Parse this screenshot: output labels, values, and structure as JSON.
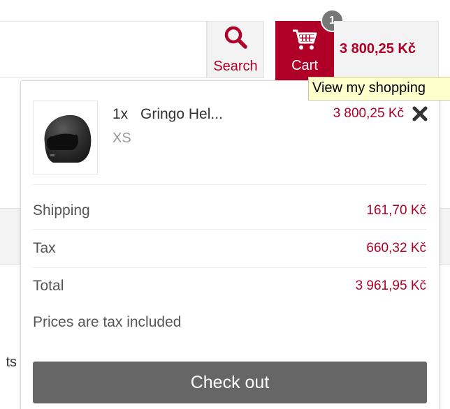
{
  "header": {
    "search_label": "Search",
    "cart_label": "Cart",
    "cart_count": "1",
    "cart_total": "3 800,25 Kč",
    "cart_tooltip": "View my shopping",
    "search_icon": "search-icon",
    "cart_icon": "cart-icon"
  },
  "cart": {
    "items": [
      {
        "qty": "1x",
        "name": "Gringo Hel...",
        "variant": "XS",
        "price": "3 800,25 Kč",
        "image": "helmet-thumbnail"
      }
    ],
    "summary": [
      {
        "label": "Shipping",
        "value": "161,70 Kč"
      },
      {
        "label": "Tax",
        "value": "660,32 Kč"
      },
      {
        "label": "Total",
        "value": "3 961,95 Kč"
      }
    ],
    "note": "Prices are tax included",
    "checkout_label": "Check out"
  },
  "background": {
    "partial_text": "ts"
  },
  "colors": {
    "accent": "#b00028",
    "button_gray": "#666666",
    "badge_gray": "#777777",
    "tooltip_bg": "#ffffcc"
  }
}
